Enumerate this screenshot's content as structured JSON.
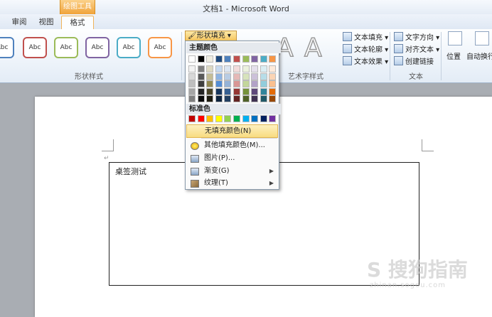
{
  "window": {
    "title": "文档1 - Microsoft Word"
  },
  "context_tab": {
    "label": "绘图工具"
  },
  "tabs": [
    {
      "label": "审阅"
    },
    {
      "label": "视图"
    },
    {
      "label": "格式"
    }
  ],
  "ribbon": {
    "shape_styles": {
      "label": "形状样式",
      "sample_text": "Abc"
    },
    "shape_fill": {
      "label": "形状填充"
    },
    "wordart": {
      "label": "艺术字样式",
      "glyph": "A"
    },
    "text_fill": {
      "label": "文本填充"
    },
    "text_outline": {
      "label": "文本轮廓"
    },
    "text_effect": {
      "label": "文本效果"
    },
    "text_direction": {
      "label": "文字方向"
    },
    "align_text": {
      "label": "对齐文本"
    },
    "create_link": {
      "label": "创建链接"
    },
    "text_group": {
      "label": "文本"
    },
    "position": {
      "label": "位置"
    },
    "autowrap": {
      "label": "自动换行"
    }
  },
  "dropdown": {
    "theme_colors_header": "主题颜色",
    "standard_colors_header": "标准色",
    "theme_top": [
      "#ffffff",
      "#000000",
      "#eeece1",
      "#1f497d",
      "#4f81bd",
      "#c0504d",
      "#9bbb59",
      "#8064a2",
      "#4bacc6",
      "#f79646"
    ],
    "theme_shades": [
      [
        "#f2f2f2",
        "#7f7f7f",
        "#ddd9c3",
        "#c6d9f0",
        "#dbe5f1",
        "#f2dcdb",
        "#ebf1dd",
        "#e5e0ec",
        "#dbeef3",
        "#fdeada"
      ],
      [
        "#d8d8d8",
        "#595959",
        "#c4bd97",
        "#8db3e2",
        "#b8cce4",
        "#e5b9b7",
        "#d7e3bc",
        "#ccc1d9",
        "#b7dde8",
        "#fbd5b5"
      ],
      [
        "#bfbfbf",
        "#3f3f3f",
        "#938953",
        "#548dd4",
        "#95b3d7",
        "#d99694",
        "#c3d69b",
        "#b2a2c7",
        "#92cddc",
        "#fac08f"
      ],
      [
        "#a5a5a5",
        "#262626",
        "#494429",
        "#17365d",
        "#366092",
        "#953734",
        "#76923c",
        "#5f497a",
        "#31859b",
        "#e36c09"
      ],
      [
        "#7f7f7f",
        "#0c0c0c",
        "#1d1b10",
        "#0f243e",
        "#244061",
        "#632423",
        "#4f6128",
        "#3f3151",
        "#205867",
        "#974806"
      ]
    ],
    "standard": [
      "#c00000",
      "#ff0000",
      "#ffc000",
      "#ffff00",
      "#92d050",
      "#00b050",
      "#00b0f0",
      "#0070c0",
      "#002060",
      "#7030a0"
    ],
    "no_fill": "无填充颜色(N)",
    "more_colors": "其他填充颜色(M)...",
    "picture": "图片(P)...",
    "gradient": "渐变(G)",
    "texture": "纹理(T)"
  },
  "document": {
    "textbox_text": "桌签测试",
    "paragraph_mark": "↵"
  },
  "watermark": {
    "text": "S 搜狗指南",
    "sub": "zhinan.sogou.com"
  }
}
